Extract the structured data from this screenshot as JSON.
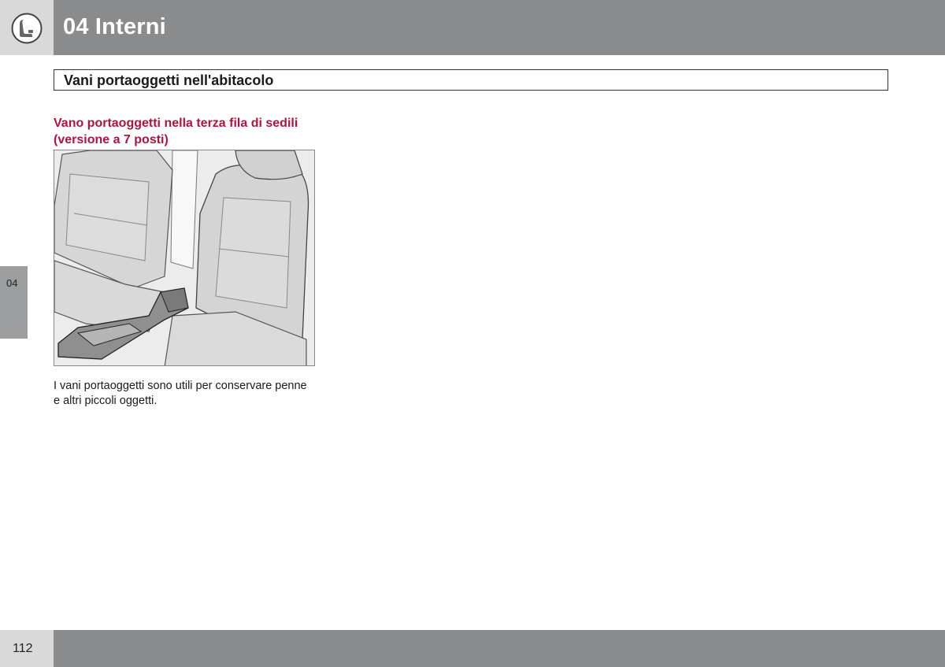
{
  "header": {
    "chapter_title": "04 Interni",
    "chapter_icon": "seat-icon"
  },
  "section": {
    "title": "Vani portaoggetti nell'abitacolo"
  },
  "content": {
    "subheading": "Vano portaoggetti nella terza fila di sedili (versione a 7 posti)",
    "figure": "seat-storage-illustration",
    "body": "I vani portaoggetti sono utili per conservare penne e altri piccoli oggetti."
  },
  "side_tab": {
    "label": "04"
  },
  "footer": {
    "page_number": "112"
  },
  "colors": {
    "header_bar": "#8a8b8d",
    "header_left": "#d9d9da",
    "subheading": "#b4123e",
    "side_tab": "#9c9d9f"
  }
}
